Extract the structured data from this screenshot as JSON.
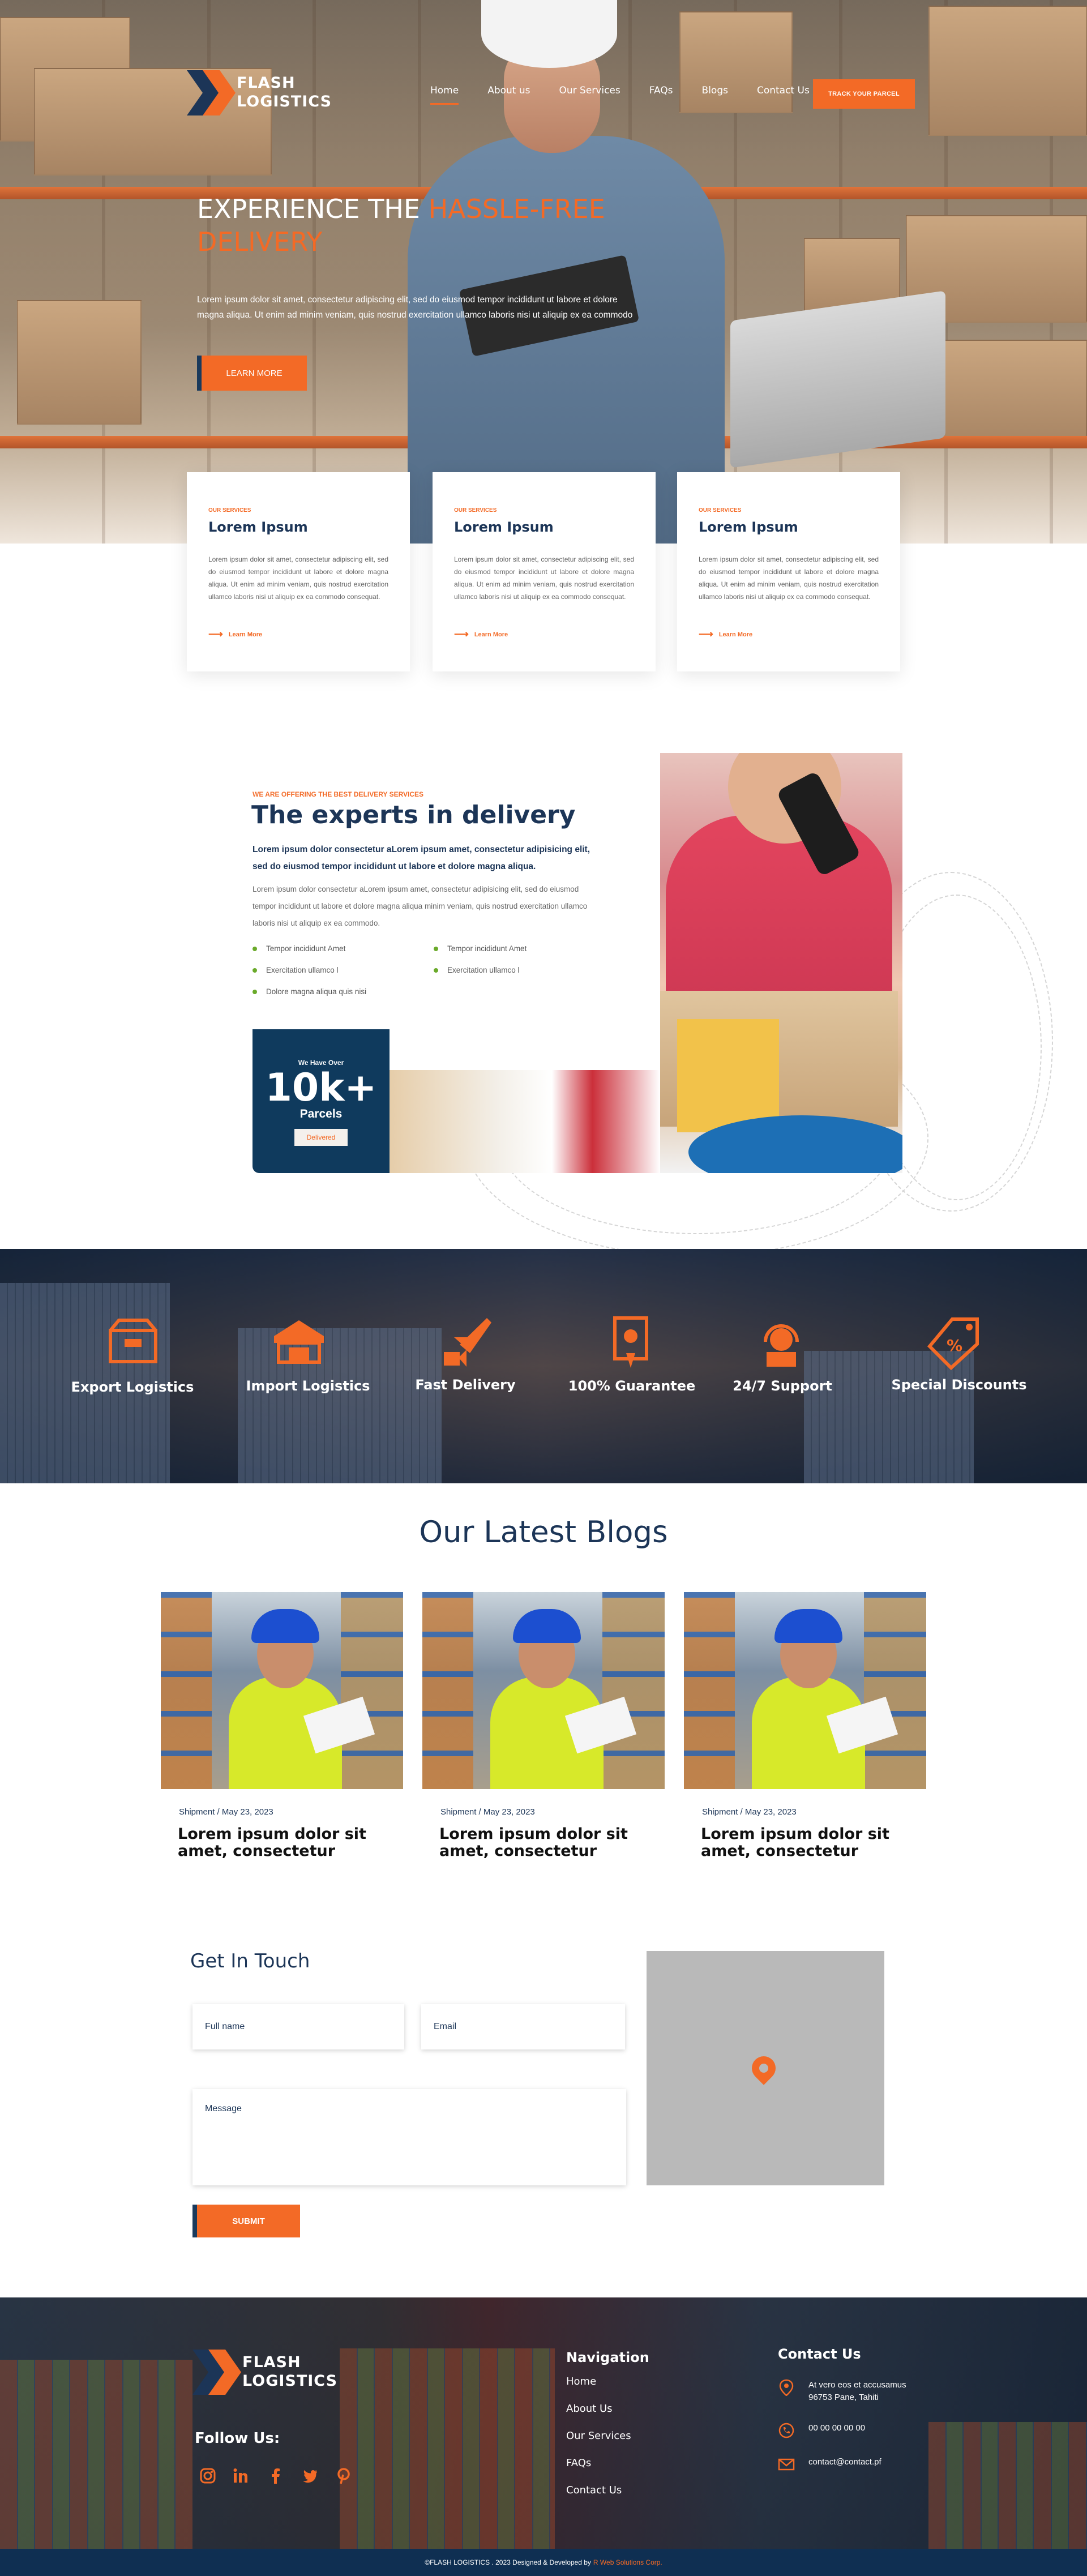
{
  "brand": {
    "line1": "FLASH",
    "line2": "LOGISTICS",
    "accent": "#f36a26",
    "navy": "#1c3557"
  },
  "nav": {
    "items": [
      "Home",
      "About us",
      "Our Services",
      "FAQs",
      "Blogs",
      "Contact Us"
    ],
    "active": "Home",
    "track_label": "TRACK YOUR PARCEL"
  },
  "hero": {
    "title_part1": "EXPERIENCE  THE ",
    "title_highlight": "HASSLE-FREE DELIVERY",
    "description": "Lorem ipsum dolor sit amet, consectetur adipiscing elit, sed do eiusmod tempor incididunt ut labore et dolore magna aliqua. Ut enim ad minim veniam, quis nostrud exercitation ullamco laboris nisi ut aliquip ex ea commodo",
    "button": "LEARN MORE"
  },
  "services": [
    {
      "tag": "OUR SERVICES",
      "title": "Lorem Ipsum",
      "text": "Lorem ipsum dolor sit amet, consectetur adipiscing elit, sed do eiusmod tempor incididunt ut labore et dolore magna aliqua. Ut enim ad minim veniam, quis nostrud exercitation ullamco laboris nisi ut aliquip ex ea commodo consequat.",
      "link": "Learn More"
    },
    {
      "tag": "OUR SERVICES",
      "title": "Lorem Ipsum",
      "text": "Lorem ipsum dolor sit amet, consectetur adipiscing elit, sed do eiusmod tempor incididunt ut labore et dolore magna aliqua. Ut enim ad minim veniam, quis nostrud exercitation ullamco laboris nisi ut aliquip ex ea commodo consequat.",
      "link": "Learn More"
    },
    {
      "tag": "OUR SERVICES",
      "title": "Lorem Ipsum",
      "text": "Lorem ipsum dolor sit amet, consectetur adipiscing elit, sed do eiusmod tempor incididunt ut labore et dolore magna aliqua. Ut enim ad minim veniam, quis nostrud exercitation ullamco laboris nisi ut aliquip ex ea commodo consequat.",
      "link": "Learn More"
    }
  ],
  "experts": {
    "subtitle": "WE ARE OFFERING THE BEST DELIVERY SERVICES",
    "title": "The experts in delivery",
    "lead": "Lorem ipsum dolor  consectetur aLorem ipsum  amet, consectetur adipisicing elit, sed do eiusmod tempor incididunt ut labore et dolore magna aliqua.",
    "body": "Lorem ipsum dolor  consectetur aLorem ipsum  amet, consectetur adipisicing elit, sed do eiusmod tempor incididunt ut labore et dolore magna aliqua minim veniam, quis nostrud exercitation ullamco laboris nisi ut aliquip ex ea commodo.",
    "checks_left": [
      "Tempor incididunt  Amet",
      "Exercitation ullamco l",
      "Dolore magna aliqua quis nisi"
    ],
    "checks_right": [
      "Tempor incididunt  Amet",
      "Exercitation ullamco l"
    ],
    "parcels": {
      "over": "We Have Over",
      "count": "10k+",
      "label": "Parcels",
      "badge": "Delivered"
    }
  },
  "features": [
    {
      "label": "Export Logistics",
      "icon": "export-box-icon"
    },
    {
      "label": "Import Logistics",
      "icon": "warehouse-icon"
    },
    {
      "label": "Fast Delivery",
      "icon": "plane-delivery-icon"
    },
    {
      "label": "100% Guarantee",
      "icon": "guarantee-document-icon"
    },
    {
      "label": "24/7 Support",
      "icon": "support-agent-icon"
    },
    {
      "label": "Special Discounts",
      "icon": "discount-tag-icon"
    }
  ],
  "blogs": {
    "title": "Our Latest Blogs",
    "items": [
      {
        "meta": "Shipment / May 23, 2023",
        "title": "Lorem ipsum dolor sit amet, consectetur"
      },
      {
        "meta": "Shipment / May 23, 2023",
        "title": "Lorem ipsum dolor sit amet, consectetur"
      },
      {
        "meta": "Shipment / May 23, 2023",
        "title": "Lorem ipsum dolor sit amet, consectetur"
      }
    ]
  },
  "contact": {
    "title": "Get In Touch",
    "full_name_placeholder": "Full name",
    "email_placeholder": "Email",
    "message_placeholder": "Message",
    "submit": "SUBMIT"
  },
  "footer": {
    "follow": "Follow Us:",
    "socials": [
      "instagram-icon",
      "linkedin-icon",
      "facebook-icon",
      "twitter-icon",
      "pinterest-icon"
    ],
    "nav_title": "Navigation",
    "nav_links": [
      "Home",
      "About Us",
      "Our Services",
      "FAQs",
      "Contact Us"
    ],
    "contact_title": "Contact Us",
    "address": "At vero eos et accusamus 96753 Pane, Tahiti",
    "phone": "00 00 00 00 00",
    "email": "contact@contact.pf",
    "copyright": "©FLASH LOGISTICS . 2023 Designed & Developed by",
    "developer": "R Web Solutions Corp."
  }
}
